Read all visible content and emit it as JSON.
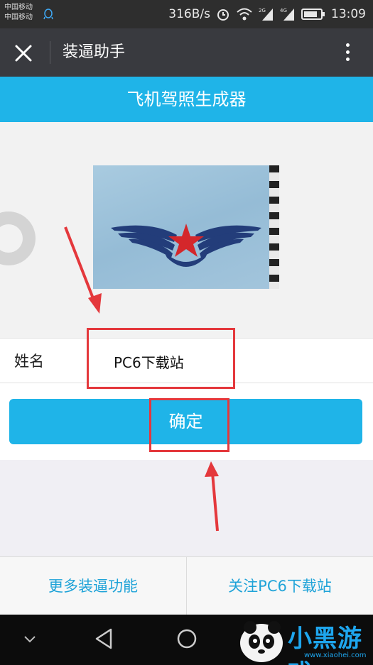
{
  "status_bar": {
    "carrier_1": "中国移动",
    "carrier_2": "中国移动",
    "net_speed": "316B/s",
    "time": "13:09",
    "signal_1_label": "2G",
    "signal_2_label": "4G"
  },
  "title_bar": {
    "title": "装逼助手"
  },
  "header": {
    "title": "飞机驾照生成器"
  },
  "form": {
    "name_label": "姓名",
    "name_value": "PC6下载站",
    "confirm_label": "确定"
  },
  "bottom_menu": {
    "left_label": "更多装逼功能",
    "right_label": "关注PC6下载站"
  },
  "watermark": {
    "text": "小黑游戏",
    "sub_text": "www.xiaohei.com"
  },
  "colors": {
    "accent": "#1fb4e8",
    "title_bar": "#393a3f",
    "highlight": "#e4383c"
  }
}
